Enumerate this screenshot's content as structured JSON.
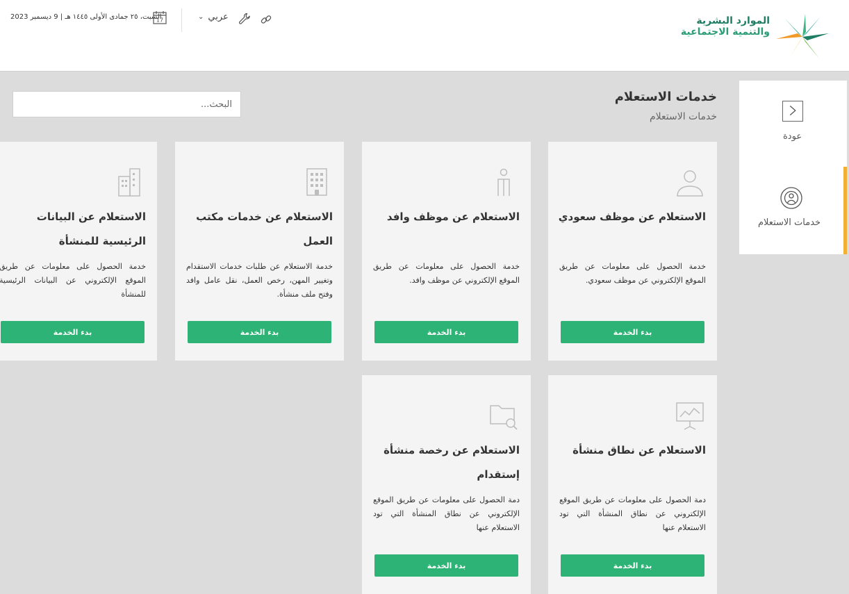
{
  "header": {
    "date": "السبت، ٢٥ جمادى الأولى ١٤٤٥ هـ | 9 ديسمبر 2023",
    "calendar_day": "17",
    "language": "عربي",
    "logo_line1": "الموارد البشرية",
    "logo_line2": "والتنمية الاجتماعية"
  },
  "sidebar": {
    "back_label": "عودة",
    "inquiry_label": "خدمات الاستعلام"
  },
  "main": {
    "title": "خدمات الاستعلام",
    "breadcrumb": "خدمات الاستعلام",
    "search_placeholder": "البحث..."
  },
  "cards": [
    {
      "icon": "person-icon",
      "title": "الاستعلام عن موظف سعودي",
      "desc": "خدمة الحصول على معلومات عن طريق الموقع الإلكتروني عن موظف سعودي.",
      "button": "بدء الخدمة"
    },
    {
      "icon": "expat-person-icon",
      "title": "الاستعلام عن موظف وافد",
      "desc": "خدمة الحصول على معلومات عن طريق الموقع الإلكتروني عن موظف وافد.",
      "button": "بدء الخدمة"
    },
    {
      "icon": "building-icon",
      "title": "الاستعلام عن خدمات مكتب العمل",
      "desc": "خدمة الاستعلام عن طلبات خدمات الاستقدام وتغيير المهن، رخص العمل، نقل عامل وافد وفتح ملف منشأة.",
      "button": "بدء الخدمة"
    },
    {
      "icon": "buildings-icon",
      "title": "الاستعلام عن البيانات الرئيسية للمنشأة",
      "desc": "خدمة الحصول على معلومات عن طريق الموقع الإلكتروني عن البيانات الرئيسية للمنشأة",
      "button": "بدء الخدمة"
    },
    {
      "icon": "presentation-chart-icon",
      "title": "الاستعلام عن نطاق منشأة",
      "desc": "دمة الحصول على معلومات عن طريق الموقع الإلكتروني عن نطاق المنشأة التي تود الاستعلام عنها",
      "button": "بدء الخدمة"
    },
    {
      "icon": "folder-search-icon",
      "title": "الاستعلام عن رخصة منشأة إستقدام",
      "desc": "دمة الحصول على معلومات عن طريق الموقع الإلكتروني عن نطاق المنشأة التي تود الاستعلام عنها",
      "button": "بدء الخدمة"
    }
  ],
  "colors": {
    "accent_green": "#2db375",
    "accent_orange": "#f2b035",
    "brand_teal": "#1e7d63"
  }
}
